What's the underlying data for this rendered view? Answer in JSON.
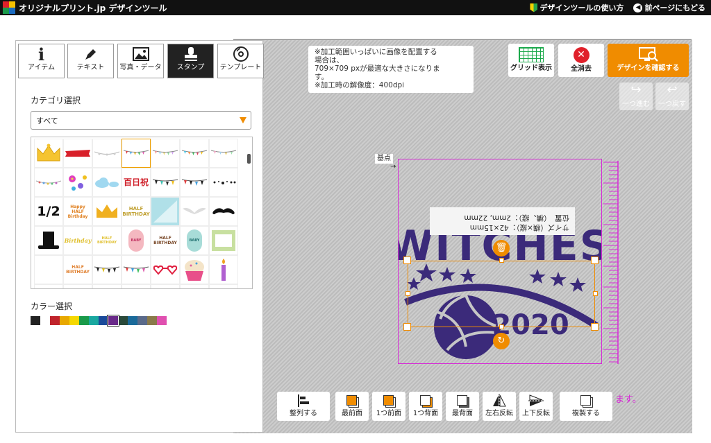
{
  "header": {
    "logo_text": "オリジナルプリント.jp デザインツール",
    "howto_link": "デザインツールの使い方",
    "back_link": "前ページにもどる"
  },
  "tabs": [
    {
      "label": "アイテム",
      "icon": "info-icon"
    },
    {
      "label": "テキスト",
      "icon": "pen-icon"
    },
    {
      "label": "写真・データ",
      "icon": "image-icon"
    },
    {
      "label": "スタンプ",
      "icon": "stamp-icon",
      "active": true
    },
    {
      "label": "テンプレート",
      "icon": "disc-icon"
    }
  ],
  "category": {
    "label": "カテゴリ選択",
    "selected": "すべて"
  },
  "stamps": {
    "texts": {
      "r3c1": "1/2",
      "r3c2": "Happy HALF Birthday",
      "r3c4": "HALF BIRTHDAY",
      "r4c2": "Birthday",
      "r4c3": "HALF BIRTHDAY",
      "r4c5": "HALF BIRTHDAY",
      "r5c2": "HALF BIRTHDAY",
      "r2c4": "百日祝",
      "r4c4": "BABY",
      "r4c6": "BABY"
    }
  },
  "color_select": {
    "label": "カラー選択",
    "colors": [
      "#222222",
      "#ffffff",
      "#c0242c",
      "#e8a800",
      "#f5d800",
      "#1a9a4a",
      "#1aa8a0",
      "#1a4a9a",
      "#6a2a8a",
      "#2a4a3a",
      "#1a6a9a",
      "#5a6a8a",
      "#8a7a4a",
      "#e050b0"
    ],
    "selected_index": 8
  },
  "info": {
    "line1": "※加工範囲いっぱいに画像を配置する",
    "line2": "場合は、",
    "line3": "709×709 pxが最適な大きさになりま",
    "line4": "す。",
    "line5": "※加工時の解像度：400dpi"
  },
  "toolbar": {
    "grid_label": "グリッド表示",
    "clear_label": "全消去",
    "confirm_label": "デザインを確認する",
    "redo_label": "一つ進む",
    "undo_label": "一つ戻す"
  },
  "canvas": {
    "origin_label": "基点",
    "design_text_top": "WITCHES",
    "design_year": "2020",
    "tooltip_size": "サイズ（横×縦）：42×15mm",
    "tooltip_pos": "位置　（横、縦）：2mm, 22mm",
    "notice_tail": "ます。"
  },
  "bottom_toolbar": {
    "align": "整列する",
    "front_most": "最前面",
    "forward": "1つ前面",
    "backward": "1つ背面",
    "back_most": "最背面",
    "flip_h": "左右反転",
    "flip_v": "上下反転",
    "duplicate": "複製する"
  },
  "colors": {
    "accent": "#f08c00",
    "design_purple": "#3b2a7a",
    "area_border": "#d62ad6"
  }
}
